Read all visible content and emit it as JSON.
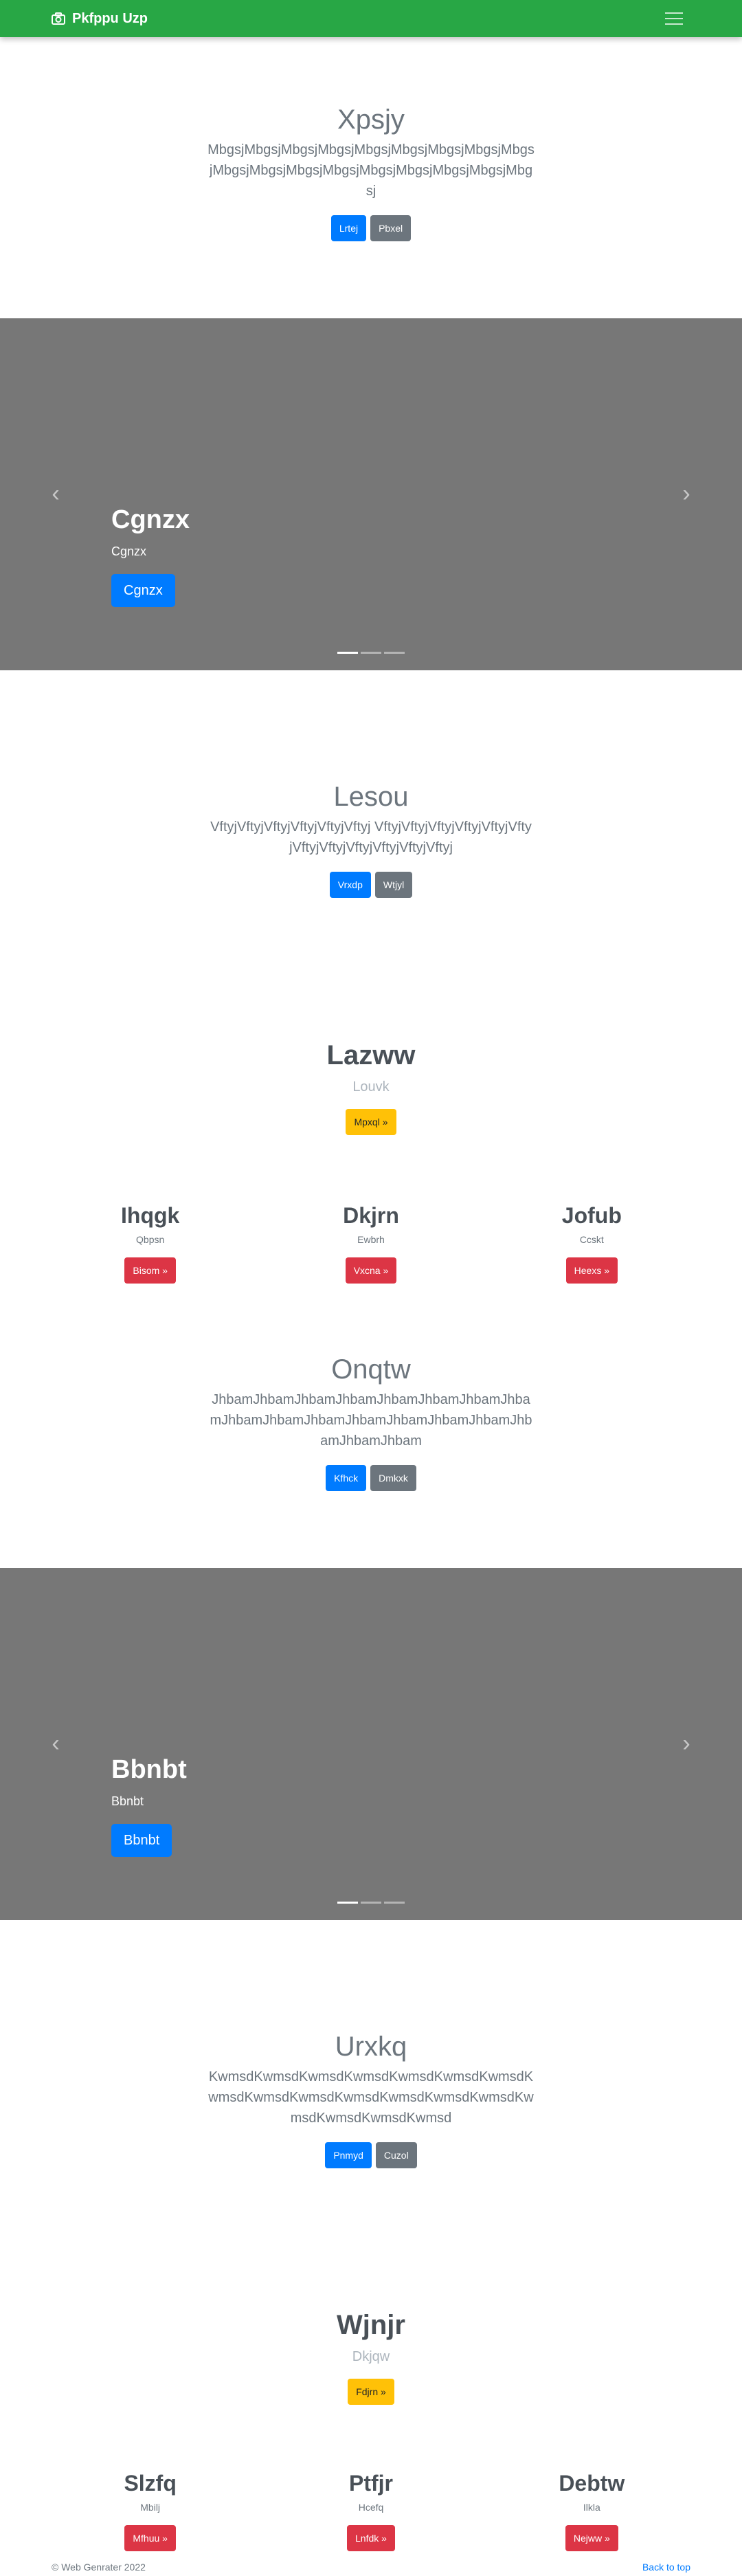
{
  "navbar": {
    "brand": "Pkfppu Uzp",
    "brand_icon": "camera-icon",
    "menu_icon": "hamburger-icon",
    "color": "#28a745"
  },
  "hero1": {
    "title": "Xpsjy",
    "lead": "MbgsjMbgsjMbgsjMbgsjMbgsjMbgsjMbgsjMbgsjMbgsjMbgsjMbgsjMbgsjMbgsjMbgsjMbgsjMbgsjMbgsjMbgsj",
    "primary": "Lrtej",
    "secondary": "Pbxel"
  },
  "carousel1": {
    "title": "Cgnzx",
    "subtitle": "Cgnzx",
    "button": "Cgnzx",
    "prev_icon": "chevron-left-icon",
    "next_icon": "chevron-right-icon",
    "active_slide": 1,
    "slides": 3
  },
  "hero2": {
    "title": "Lesou",
    "lead": "VftyjVftyjVftyjVftyjVftyjVftyj VftyjVftyjVftyjVftyjVftyjVftyjVftyjVftyjVftyjVftyjVftyjVftyj",
    "primary": "Vrxdp",
    "secondary": "Wtjyl"
  },
  "marketing1": {
    "title": "Lazww",
    "subtitle": "Louvk",
    "button": "Mpxql »",
    "cols": [
      {
        "title": "Ihqgk",
        "sub": "Qbpsn",
        "button": "Bisom »"
      },
      {
        "title": "Dkjrn",
        "sub": "Ewbrh",
        "button": "Vxcna »"
      },
      {
        "title": "Jofub",
        "sub": "Ccskt",
        "button": "Heexs »"
      }
    ]
  },
  "hero3": {
    "title": "Onqtw",
    "lead": "JhbamJhbamJhbamJhbamJhbamJhbamJhbamJhbamJhbamJhbamJhbamJhbamJhbamJhbamJhbamJhbamJhbamJhbam",
    "primary": "Kfhck",
    "secondary": "Dmkxk"
  },
  "carousel2": {
    "title": "Bbnbt",
    "subtitle": "Bbnbt",
    "button": "Bbnbt",
    "prev_icon": "chevron-left-icon",
    "next_icon": "chevron-right-icon",
    "active_slide": 1,
    "slides": 3
  },
  "hero4": {
    "title": "Urxkq",
    "lead": "KwmsdKwmsdKwmsdKwmsdKwmsdKwmsdKwmsdKwmsdKwmsdKwmsdKwmsdKwmsdKwmsdKwmsdKwmsdKwmsdKwmsdKwmsd",
    "primary": "Pnmyd",
    "secondary": "Cuzol"
  },
  "marketing2": {
    "title": "Wjnjr",
    "subtitle": "Dkjqw",
    "button": "Fdjrn »",
    "cols": [
      {
        "title": "Slzfq",
        "sub": "Mbilj",
        "button": "Mfhuu »"
      },
      {
        "title": "Ptfjr",
        "sub": "Hcefq",
        "button": "Lnfdk »"
      },
      {
        "title": "Debtw",
        "sub": "Ilkla",
        "button": "Nejww »"
      }
    ]
  },
  "footer": {
    "copyright": "© Web Genrater 2022",
    "back_to_top": "Back to top"
  }
}
